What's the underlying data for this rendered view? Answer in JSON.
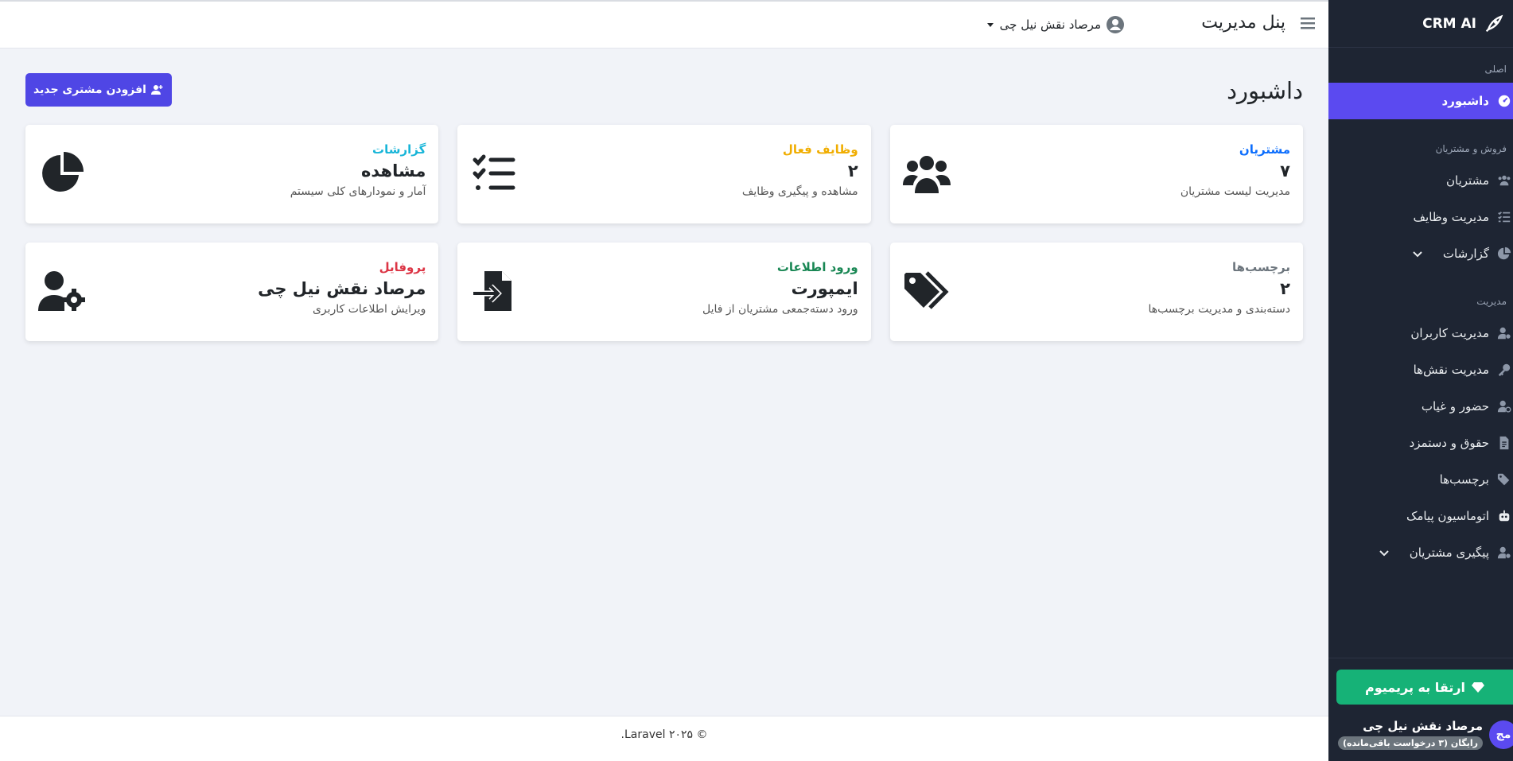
{
  "brand": {
    "name": "CRM AI"
  },
  "topbar": {
    "title": "پنل مدیریت",
    "user_name": "مرصاد نقش نیل چی"
  },
  "sidebar": {
    "sections": [
      {
        "title": "اصلی"
      },
      {
        "title": "فروش و مشتریان"
      },
      {
        "title": "مدیریت"
      }
    ],
    "items": [
      {
        "label": "داشبورد",
        "icon": "gauge-icon",
        "active": true
      },
      {
        "label": "مشتریان",
        "icon": "users-icon"
      },
      {
        "label": "مدیریت وظایف",
        "icon": "tasks-icon"
      },
      {
        "label": "گزارشات",
        "icon": "pie-chart-icon",
        "expandable": true
      },
      {
        "label": "مدیریت کاربران",
        "icon": "user-cog-icon"
      },
      {
        "label": "مدیریت نقش‌ها",
        "icon": "key-icon"
      },
      {
        "label": "حضور و غیاب",
        "icon": "user-clock-icon"
      },
      {
        "label": "حقوق و دستمزد",
        "icon": "invoice-icon"
      },
      {
        "label": "برچسب‌ها",
        "icon": "tags-icon"
      },
      {
        "label": "اتوماسیون پیامک",
        "icon": "robot-icon"
      },
      {
        "label": "پیگیری مشتریان",
        "icon": "user-follow-icon",
        "expandable": true
      }
    ],
    "premium_label": "ارتقا به پریمیوم",
    "user": {
      "initials": "مج",
      "name": "مرصاد نقش نیل چی",
      "plan": "رایگان (۳ درخواست باقی‌مانده)"
    }
  },
  "main": {
    "title": "داشبورد",
    "add_customer_label": "افزودن مشتری جدید",
    "cards": [
      {
        "kicker": "مشتریان",
        "kicker_color": "#0d6efd",
        "value": "۷",
        "desc": "مدیریت لیست مشتریان",
        "icon": "users-icon"
      },
      {
        "kicker": "وظایف فعال",
        "kicker_color": "#f0ad00",
        "value": "۲",
        "desc": "مشاهده و پیگیری وظایف",
        "icon": "tasks-icon"
      },
      {
        "kicker": "گزارشات",
        "kicker_color": "#17b5d8",
        "value": "مشاهده",
        "desc": "آمار و نمودارهای کلی سیستم",
        "icon": "pie-chart-icon"
      },
      {
        "kicker": "برچسب‌ها",
        "kicker_color": "#6c757d",
        "value": "۲",
        "desc": "دسته‌بندی و مدیریت برچسب‌ها",
        "icon": "tags-icon"
      },
      {
        "kicker": "ورود اطلاعات",
        "kicker_color": "#198754",
        "value": "ایمپورت",
        "desc": "ورود دسته‌جمعی مشتریان از فایل",
        "icon": "file-import-icon"
      },
      {
        "kicker": "پروفایل",
        "kicker_color": "#dc3545",
        "value": "مرصاد نقش نیل چی",
        "desc": "ویرایش اطلاعات کاربری",
        "icon": "user-gear-icon"
      }
    ]
  },
  "footer": {
    "text": "© ۲۰۲۵ Laravel."
  }
}
